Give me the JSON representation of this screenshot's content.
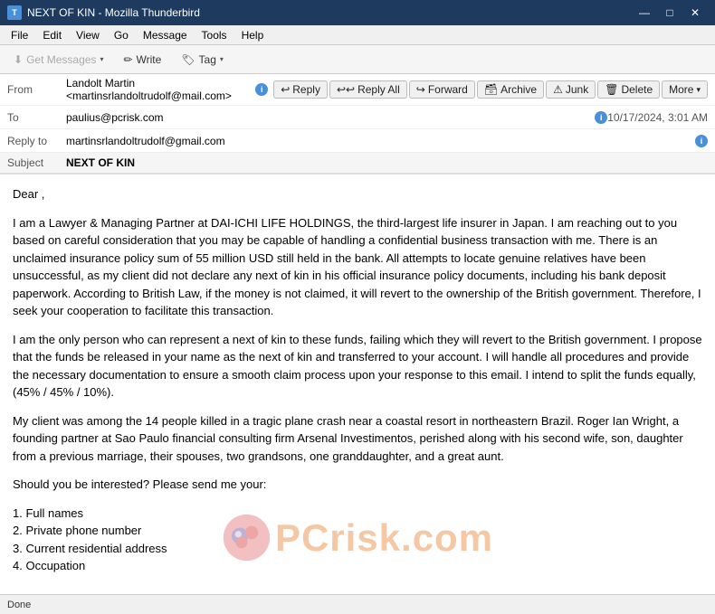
{
  "titlebar": {
    "title": "NEXT OF KIN - Mozilla Thunderbird",
    "icon_label": "T",
    "controls": {
      "minimize": "—",
      "maximize": "□",
      "close": "✕"
    }
  },
  "menubar": {
    "items": [
      "File",
      "Edit",
      "View",
      "Go",
      "Message",
      "Tools",
      "Help"
    ]
  },
  "toolbar": {
    "get_messages_label": "Get Messages",
    "write_label": "Write",
    "tag_label": "Tag"
  },
  "email": {
    "from_label": "From",
    "from_value": "Landolt Martin <martinsrlandoltrudolf@mail.com>",
    "to_label": "To",
    "to_value": "paulius@pcrisk.com",
    "reply_to_label": "Reply to",
    "reply_to_value": "martinsrlandoltrudolf@gmail.com",
    "subject_label": "Subject",
    "subject_value": "NEXT OF KIN",
    "date": "10/17/2024, 3:01 AM",
    "actions": {
      "reply": "Reply",
      "reply_all": "Reply All",
      "forward": "Forward",
      "archive": "Archive",
      "junk": "Junk",
      "delete": "Delete",
      "more": "More"
    },
    "body": [
      "Dear ,",
      "I am a Lawyer & Managing Partner at DAI-ICHI LIFE HOLDINGS, the third-largest life insurer in Japan. I am reaching out to you based on careful consideration that you may be capable of handling a confidential business transaction with me. There is an unclaimed insurance policy sum of 55 million USD still held in the bank. All attempts to locate genuine relatives have been unsuccessful, as my client did not declare any next of kin in his official insurance policy documents, including his bank deposit paperwork. According to British Law, if the money is not claimed, it will revert to the ownership of the British government. Therefore, I seek your cooperation to facilitate this transaction.",
      "I am the only person who can represent a next of kin to these funds, failing which they will revert to the British government. I propose that the funds be released in your name as the next of kin and transferred to your account. I will handle all procedures and provide the necessary documentation to ensure a smooth claim process upon your response to this email. I intend to split the funds equally, (45% / 45% / 10%).",
      "My client was among the 14 people killed in a tragic plane crash near a coastal resort in northeastern Brazil. Roger Ian Wright, a founding partner at Sao Paulo financial consulting firm Arsenal Investimentos, perished along with his second wife, son, daughter from a previous marriage, their spouses, two grandsons, one granddaughter, and a great aunt.",
      "Should you be interested? Please send me your:",
      "1. Full names\n2. Private phone number\n3. Current residential address\n4. Occupation"
    ]
  },
  "statusbar": {
    "status": "Done"
  },
  "watermark": {
    "text": "PCrisk.com"
  }
}
